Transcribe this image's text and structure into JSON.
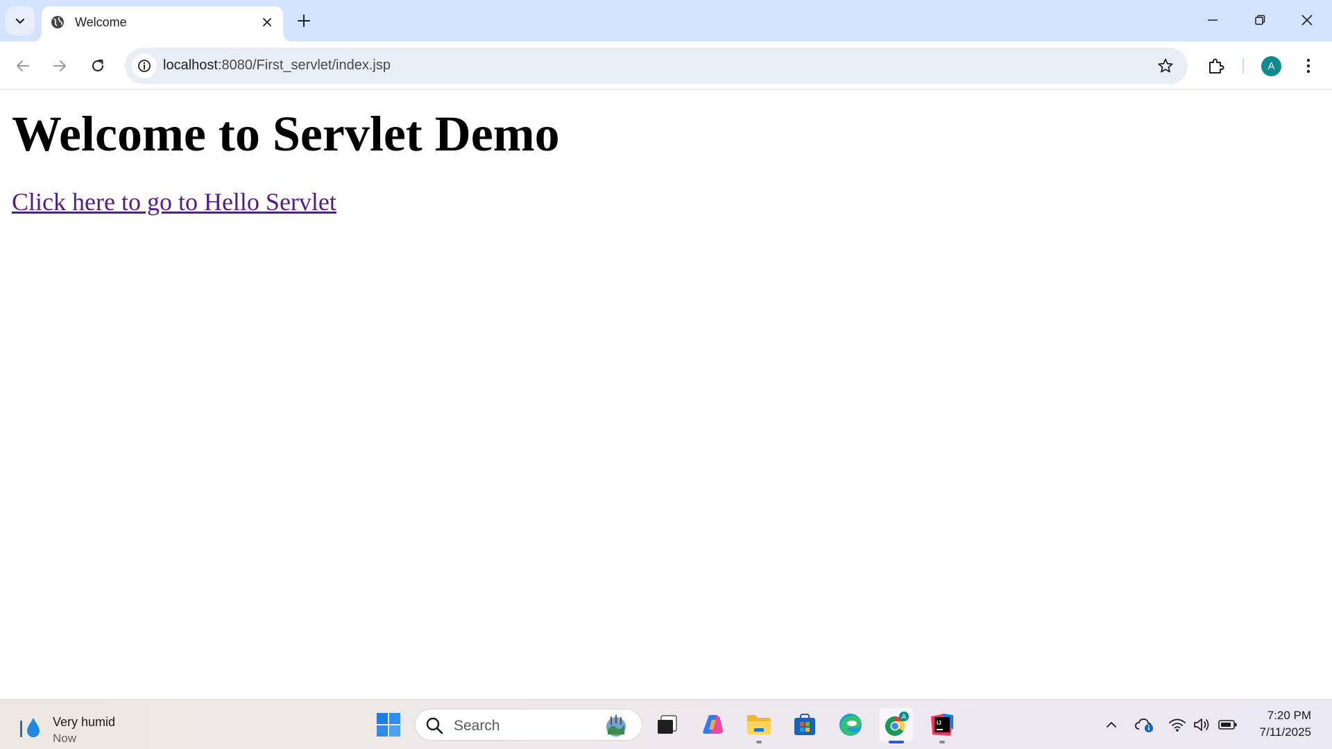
{
  "browser": {
    "tab": {
      "title": "Welcome"
    },
    "address_bar": {
      "host": "localhost",
      "path": ":8080/First_servlet/index.jsp"
    },
    "profile_initial": "A"
  },
  "page": {
    "heading": "Welcome to Servlet Demo",
    "link_text": "Click here to go to Hello Servlet"
  },
  "taskbar": {
    "weather": {
      "title": "Very humid",
      "subtitle": "Now"
    },
    "search_placeholder": "Search",
    "apps": [
      "start-icon",
      "task-view-icon",
      "copilot-icon",
      "file-explorer-icon",
      "microsoft-store-icon",
      "edge-icon",
      "chrome-icon",
      "intellij-icon"
    ],
    "clock": {
      "time": "7:20 PM",
      "date": "7/11/2025"
    }
  },
  "colors": {
    "tabstrip": "#d3e3fd",
    "link_visited": "#551a8b",
    "avatar": "#0b8a8f"
  }
}
